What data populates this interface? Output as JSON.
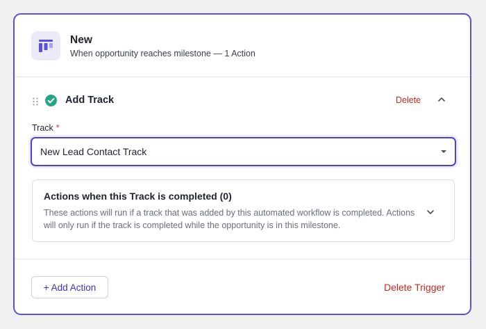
{
  "header": {
    "title": "New",
    "subtitle": "When opportunity reaches milestone — 1 Action",
    "icon": "workflow-board-icon"
  },
  "action": {
    "title": "Add Track",
    "status_icon": "check-circle-icon",
    "delete_label": "Delete",
    "collapse_icon": "chevron-up-icon",
    "track_field": {
      "label": "Track",
      "required_marker": "*",
      "value": "New Lead Contact Track"
    },
    "completed_section": {
      "title": "Actions when this Track is completed (0)",
      "description": "These actions will run if a track that was added by this automated workflow is completed. Actions will only run if the track is completed while the opportunity is in this milestone.",
      "expand_icon": "chevron-down-icon"
    }
  },
  "footer": {
    "add_action_label": "+ Add Action",
    "delete_trigger_label": "Delete Trigger"
  },
  "colors": {
    "accent": "#5b4fe0",
    "success": "#27a58a",
    "danger": "#c4271f"
  }
}
